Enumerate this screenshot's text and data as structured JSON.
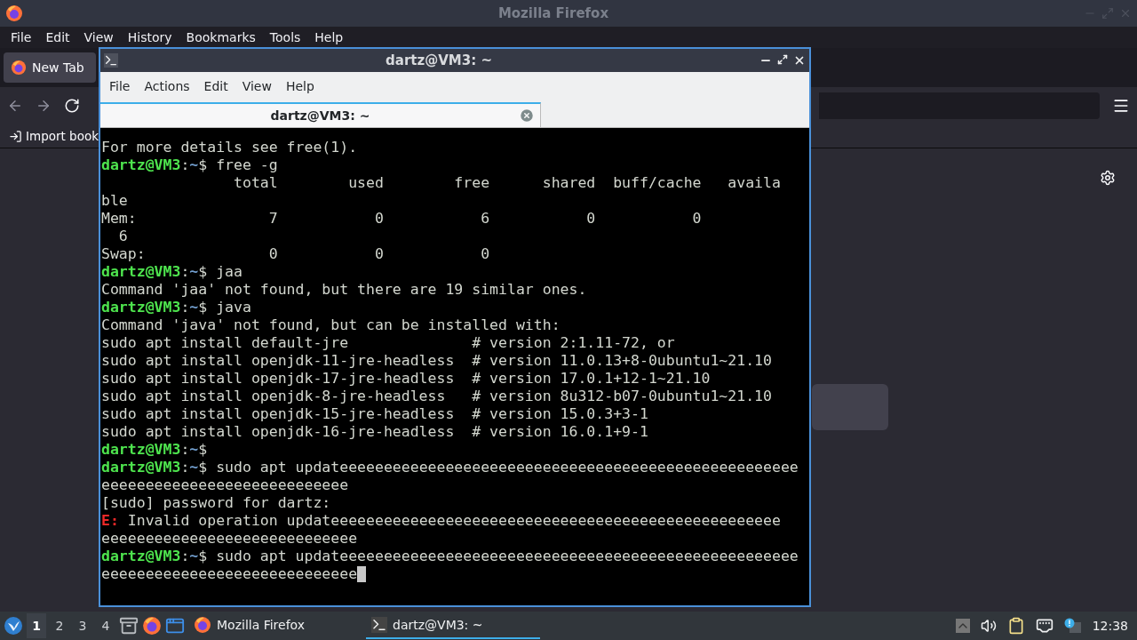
{
  "firefox": {
    "title": "Mozilla Firefox",
    "menu": [
      "File",
      "Edit",
      "View",
      "History",
      "Bookmarks",
      "Tools",
      "Help"
    ],
    "tabs": [
      {
        "label": "New Tab",
        "selected": true
      }
    ],
    "bookmarks": [
      "Import book"
    ]
  },
  "terminal": {
    "title": "dartz@VM3: ~",
    "menu": [
      "File",
      "Actions",
      "Edit",
      "View",
      "Help"
    ],
    "tabs": [
      {
        "label": "dartz@VM3: ~",
        "selected": true
      }
    ],
    "lines": [
      [
        {
          "kind": "plain",
          "text": "For more details see free(1)."
        }
      ],
      [
        {
          "kind": "user",
          "text": "dartz@VM3"
        },
        {
          "kind": "plain",
          "text": ":"
        },
        {
          "kind": "path",
          "text": "~"
        },
        {
          "kind": "plain",
          "text": "$ free -g"
        }
      ],
      [
        {
          "kind": "plain",
          "text": "               total        used        free      shared  buff/cache   availa"
        }
      ],
      [
        {
          "kind": "plain",
          "text": "ble"
        }
      ],
      [
        {
          "kind": "plain",
          "text": "Mem:               7           0           6           0           0"
        }
      ],
      [
        {
          "kind": "plain",
          "text": "  6"
        }
      ],
      [
        {
          "kind": "plain",
          "text": "Swap:              0           0           0"
        }
      ],
      [
        {
          "kind": "user",
          "text": "dartz@VM3"
        },
        {
          "kind": "plain",
          "text": ":"
        },
        {
          "kind": "path",
          "text": "~"
        },
        {
          "kind": "plain",
          "text": "$ jaa"
        }
      ],
      [
        {
          "kind": "plain",
          "text": "Command 'jaa' not found, but there are 19 similar ones."
        }
      ],
      [
        {
          "kind": "user",
          "text": "dartz@VM3"
        },
        {
          "kind": "plain",
          "text": ":"
        },
        {
          "kind": "path",
          "text": "~"
        },
        {
          "kind": "plain",
          "text": "$ java"
        }
      ],
      [
        {
          "kind": "plain",
          "text": "Command 'java' not found, but can be installed with:"
        }
      ],
      [
        {
          "kind": "plain",
          "text": "sudo apt install default-jre              # version 2:1.11-72, or"
        }
      ],
      [
        {
          "kind": "plain",
          "text": "sudo apt install openjdk-11-jre-headless  # version 11.0.13+8-0ubuntu1~21.10"
        }
      ],
      [
        {
          "kind": "plain",
          "text": "sudo apt install openjdk-17-jre-headless  # version 17.0.1+12-1~21.10"
        }
      ],
      [
        {
          "kind": "plain",
          "text": "sudo apt install openjdk-8-jre-headless   # version 8u312-b07-0ubuntu1~21.10"
        }
      ],
      [
        {
          "kind": "plain",
          "text": "sudo apt install openjdk-15-jre-headless  # version 15.0.3+3-1"
        }
      ],
      [
        {
          "kind": "plain",
          "text": "sudo apt install openjdk-16-jre-headless  # version 16.0.1+9-1"
        }
      ],
      [
        {
          "kind": "user",
          "text": "dartz@VM3"
        },
        {
          "kind": "plain",
          "text": ":"
        },
        {
          "kind": "path",
          "text": "~"
        },
        {
          "kind": "plain",
          "text": "$"
        }
      ],
      [
        {
          "kind": "user",
          "text": "dartz@VM3"
        },
        {
          "kind": "plain",
          "text": ":"
        },
        {
          "kind": "path",
          "text": "~"
        },
        {
          "kind": "plain",
          "text": "$ sudo apt updateeeeeeeeeeeeeeeeeeeeeeeeeeeeeeeeeeeeeeeeeeeeeeeeeeee"
        }
      ],
      [
        {
          "kind": "plain",
          "text": "eeeeeeeeeeeeeeeeeeeeeeeeeeee"
        }
      ],
      [
        {
          "kind": "plain",
          "text": "[sudo] password for dartz:"
        }
      ],
      [
        {
          "kind": "error",
          "text": "E:"
        },
        {
          "kind": "plain",
          "text": " Invalid operation updateeeeeeeeeeeeeeeeeeeeeeeeeeeeeeeeeeeeeeeeeeeeeeeeeee"
        }
      ],
      [
        {
          "kind": "plain",
          "text": "eeeeeeeeeeeeeeeeeeeeeeeeeeeee"
        }
      ],
      [
        {
          "kind": "user",
          "text": "dartz@VM3"
        },
        {
          "kind": "plain",
          "text": ":"
        },
        {
          "kind": "path",
          "text": "~"
        },
        {
          "kind": "plain",
          "text": "$ sudo apt updateeeeeeeeeeeeeeeeeeeeeeeeeeeeeeeeeeeeeeeeeeeeeeeeeeee"
        }
      ],
      [
        {
          "kind": "plain",
          "text": "eeeeeeeeeeeeeeeeeeeeeeeeeeeee"
        }
      ]
    ]
  },
  "taskbar": {
    "workspaces": [
      {
        "label": "1",
        "selected": true
      },
      {
        "label": "2",
        "selected": false
      },
      {
        "label": "3",
        "selected": false
      },
      {
        "label": "4",
        "selected": false
      }
    ],
    "tasks": [
      {
        "label": "Mozilla Firefox",
        "kind": "browser",
        "selected": false
      },
      {
        "label": "dartz@VM3: ~",
        "kind": "terminal",
        "selected": true
      }
    ],
    "clock": "12:38"
  }
}
